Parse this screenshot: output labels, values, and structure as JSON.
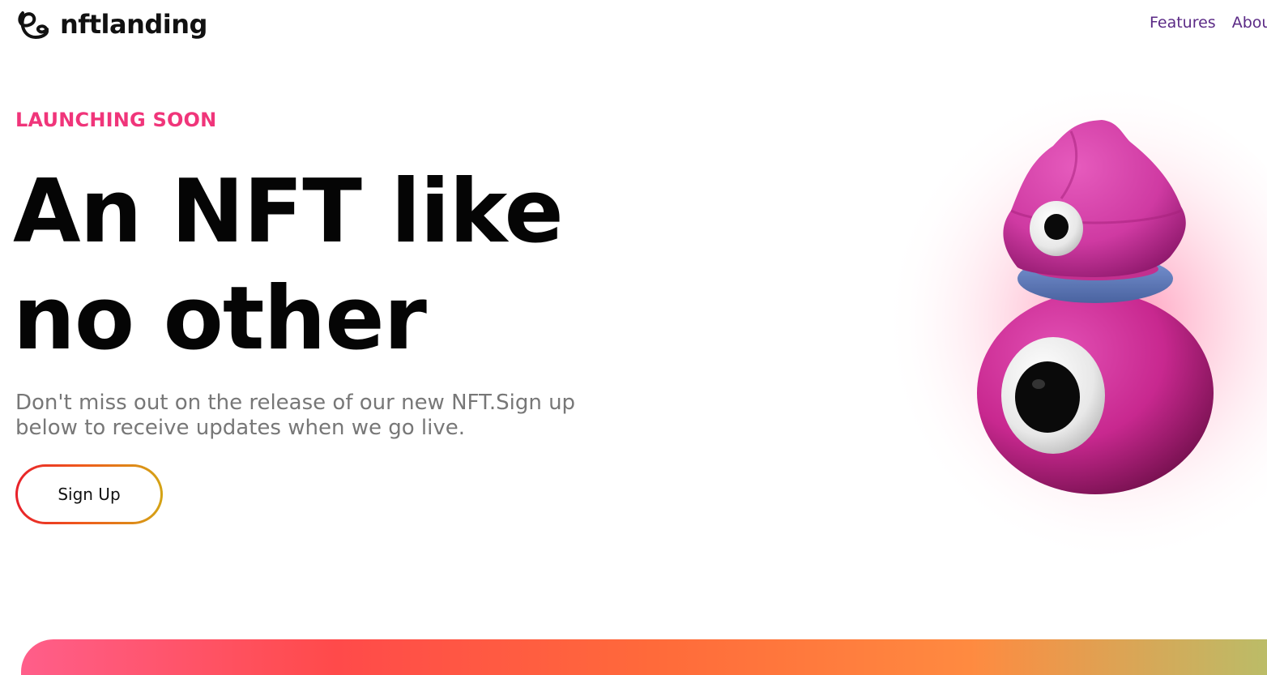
{
  "header": {
    "logo_text": "nftlanding",
    "nav": [
      {
        "label": "Features"
      },
      {
        "label": "About"
      }
    ]
  },
  "hero": {
    "eyebrow": "LAUNCHING SOON",
    "headline_line1": "An NFT like",
    "headline_line2": "no other",
    "subtext": "Don't miss out on the release of our new NFT.Sign up below to receive updates when we go live.",
    "cta_label": "Sign Up"
  },
  "colors": {
    "accent_pink": "#f0357a",
    "nav_purple": "#5b2a86",
    "character_pink": "#d6309f",
    "collar_blue": "#5a78b8"
  }
}
